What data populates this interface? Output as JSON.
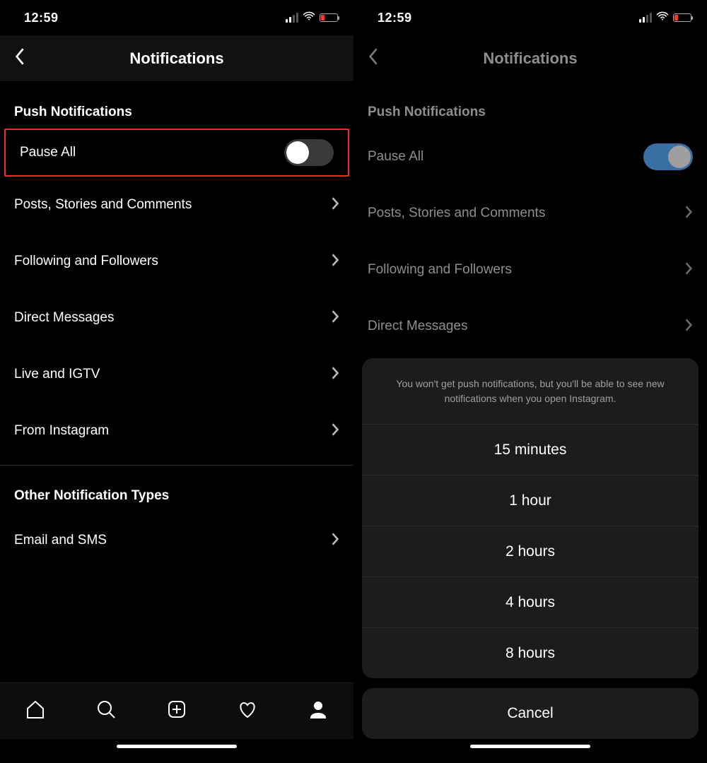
{
  "status": {
    "time": "12:59"
  },
  "nav": {
    "title": "Notifications"
  },
  "left": {
    "section1_header": "Push Notifications",
    "pause_all_label": "Pause All",
    "pause_all_on": false,
    "items1": [
      "Posts, Stories and Comments",
      "Following and Followers",
      "Direct Messages",
      "Live and IGTV",
      "From Instagram"
    ],
    "section2_header": "Other Notification Types",
    "items2": [
      "Email and SMS"
    ]
  },
  "right": {
    "section1_header": "Push Notifications",
    "pause_all_label": "Pause All",
    "pause_all_on": true,
    "items1": [
      "Posts, Stories and Comments",
      "Following and Followers",
      "Direct Messages"
    ],
    "sheet": {
      "message": "You won't get push notifications, but you'll be able to see new notifications when you open Instagram.",
      "options": [
        "15 minutes",
        "1 hour",
        "2 hours",
        "4 hours",
        "8 hours"
      ],
      "cancel": "Cancel"
    }
  }
}
